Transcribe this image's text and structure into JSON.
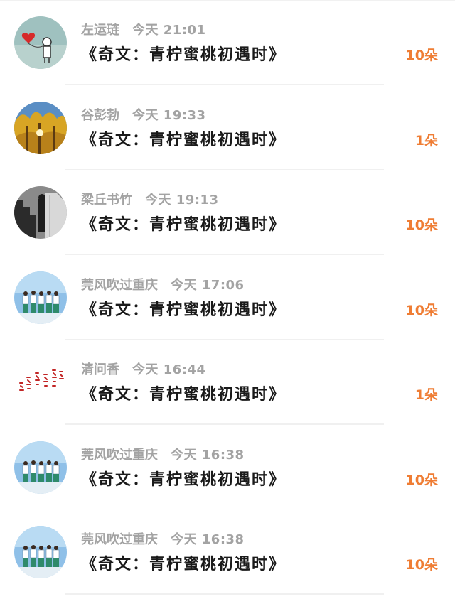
{
  "records": [
    {
      "sender": "左运琏",
      "time": "今天 21:01",
      "gift": "《奇文：青柠蜜桃初遇时》",
      "count": "10朵",
      "avatar": "heart-balloon-avatar"
    },
    {
      "sender": "谷彭勃",
      "time": "今天 19:33",
      "gift": "《奇文：青柠蜜桃初遇时》",
      "count": "1朵",
      "avatar": "golden-trees-avatar"
    },
    {
      "sender": "梁丘书竹",
      "time": "今天 19:13",
      "gift": "《奇文：青柠蜜桃初遇时》",
      "count": "10朵",
      "avatar": "staircase-bw-avatar"
    },
    {
      "sender": "莞风吹过重庆",
      "time": "今天 17:06",
      "gift": "《奇文：青柠蜜桃初遇时》",
      "count": "10朵",
      "avatar": "students-sky-avatar"
    },
    {
      "sender": "清问香",
      "time": "今天 16:44",
      "gift": "《奇文：青柠蜜桃初遇时》",
      "count": "1朵",
      "avatar": "red-calligraphy-avatar"
    },
    {
      "sender": "莞风吹过重庆",
      "time": "今天 16:38",
      "gift": "《奇文：青柠蜜桃初遇时》",
      "count": "10朵",
      "avatar": "students-sky-avatar"
    },
    {
      "sender": "莞风吹过重庆",
      "time": "今天 16:38",
      "gift": "《奇文：青柠蜜桃初遇时》",
      "count": "10朵",
      "avatar": "students-sky-avatar"
    }
  ],
  "colors": {
    "count": "#ef7d34",
    "sender": "#a3a3a3",
    "gift": "#1a1a1a",
    "divider": "#f0f0f0"
  }
}
